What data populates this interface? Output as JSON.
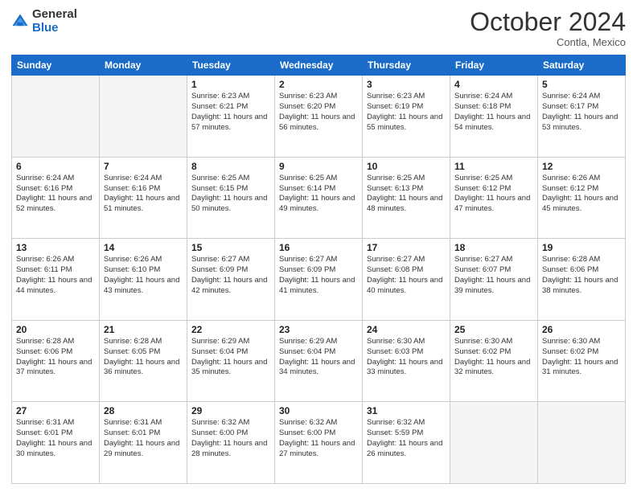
{
  "header": {
    "logo_general": "General",
    "logo_blue": "Blue",
    "month": "October 2024",
    "location": "Contla, Mexico"
  },
  "weekdays": [
    "Sunday",
    "Monday",
    "Tuesday",
    "Wednesday",
    "Thursday",
    "Friday",
    "Saturday"
  ],
  "weeks": [
    [
      {
        "day": "",
        "empty": true
      },
      {
        "day": "",
        "empty": true
      },
      {
        "day": "1",
        "sunrise": "Sunrise: 6:23 AM",
        "sunset": "Sunset: 6:21 PM",
        "daylight": "Daylight: 11 hours and 57 minutes."
      },
      {
        "day": "2",
        "sunrise": "Sunrise: 6:23 AM",
        "sunset": "Sunset: 6:20 PM",
        "daylight": "Daylight: 11 hours and 56 minutes."
      },
      {
        "day": "3",
        "sunrise": "Sunrise: 6:23 AM",
        "sunset": "Sunset: 6:19 PM",
        "daylight": "Daylight: 11 hours and 55 minutes."
      },
      {
        "day": "4",
        "sunrise": "Sunrise: 6:24 AM",
        "sunset": "Sunset: 6:18 PM",
        "daylight": "Daylight: 11 hours and 54 minutes."
      },
      {
        "day": "5",
        "sunrise": "Sunrise: 6:24 AM",
        "sunset": "Sunset: 6:17 PM",
        "daylight": "Daylight: 11 hours and 53 minutes."
      }
    ],
    [
      {
        "day": "6",
        "sunrise": "Sunrise: 6:24 AM",
        "sunset": "Sunset: 6:16 PM",
        "daylight": "Daylight: 11 hours and 52 minutes."
      },
      {
        "day": "7",
        "sunrise": "Sunrise: 6:24 AM",
        "sunset": "Sunset: 6:16 PM",
        "daylight": "Daylight: 11 hours and 51 minutes."
      },
      {
        "day": "8",
        "sunrise": "Sunrise: 6:25 AM",
        "sunset": "Sunset: 6:15 PM",
        "daylight": "Daylight: 11 hours and 50 minutes."
      },
      {
        "day": "9",
        "sunrise": "Sunrise: 6:25 AM",
        "sunset": "Sunset: 6:14 PM",
        "daylight": "Daylight: 11 hours and 49 minutes."
      },
      {
        "day": "10",
        "sunrise": "Sunrise: 6:25 AM",
        "sunset": "Sunset: 6:13 PM",
        "daylight": "Daylight: 11 hours and 48 minutes."
      },
      {
        "day": "11",
        "sunrise": "Sunrise: 6:25 AM",
        "sunset": "Sunset: 6:12 PM",
        "daylight": "Daylight: 11 hours and 47 minutes."
      },
      {
        "day": "12",
        "sunrise": "Sunrise: 6:26 AM",
        "sunset": "Sunset: 6:12 PM",
        "daylight": "Daylight: 11 hours and 45 minutes."
      }
    ],
    [
      {
        "day": "13",
        "sunrise": "Sunrise: 6:26 AM",
        "sunset": "Sunset: 6:11 PM",
        "daylight": "Daylight: 11 hours and 44 minutes."
      },
      {
        "day": "14",
        "sunrise": "Sunrise: 6:26 AM",
        "sunset": "Sunset: 6:10 PM",
        "daylight": "Daylight: 11 hours and 43 minutes."
      },
      {
        "day": "15",
        "sunrise": "Sunrise: 6:27 AM",
        "sunset": "Sunset: 6:09 PM",
        "daylight": "Daylight: 11 hours and 42 minutes."
      },
      {
        "day": "16",
        "sunrise": "Sunrise: 6:27 AM",
        "sunset": "Sunset: 6:09 PM",
        "daylight": "Daylight: 11 hours and 41 minutes."
      },
      {
        "day": "17",
        "sunrise": "Sunrise: 6:27 AM",
        "sunset": "Sunset: 6:08 PM",
        "daylight": "Daylight: 11 hours and 40 minutes."
      },
      {
        "day": "18",
        "sunrise": "Sunrise: 6:27 AM",
        "sunset": "Sunset: 6:07 PM",
        "daylight": "Daylight: 11 hours and 39 minutes."
      },
      {
        "day": "19",
        "sunrise": "Sunrise: 6:28 AM",
        "sunset": "Sunset: 6:06 PM",
        "daylight": "Daylight: 11 hours and 38 minutes."
      }
    ],
    [
      {
        "day": "20",
        "sunrise": "Sunrise: 6:28 AM",
        "sunset": "Sunset: 6:06 PM",
        "daylight": "Daylight: 11 hours and 37 minutes."
      },
      {
        "day": "21",
        "sunrise": "Sunrise: 6:28 AM",
        "sunset": "Sunset: 6:05 PM",
        "daylight": "Daylight: 11 hours and 36 minutes."
      },
      {
        "day": "22",
        "sunrise": "Sunrise: 6:29 AM",
        "sunset": "Sunset: 6:04 PM",
        "daylight": "Daylight: 11 hours and 35 minutes."
      },
      {
        "day": "23",
        "sunrise": "Sunrise: 6:29 AM",
        "sunset": "Sunset: 6:04 PM",
        "daylight": "Daylight: 11 hours and 34 minutes."
      },
      {
        "day": "24",
        "sunrise": "Sunrise: 6:30 AM",
        "sunset": "Sunset: 6:03 PM",
        "daylight": "Daylight: 11 hours and 33 minutes."
      },
      {
        "day": "25",
        "sunrise": "Sunrise: 6:30 AM",
        "sunset": "Sunset: 6:02 PM",
        "daylight": "Daylight: 11 hours and 32 minutes."
      },
      {
        "day": "26",
        "sunrise": "Sunrise: 6:30 AM",
        "sunset": "Sunset: 6:02 PM",
        "daylight": "Daylight: 11 hours and 31 minutes."
      }
    ],
    [
      {
        "day": "27",
        "sunrise": "Sunrise: 6:31 AM",
        "sunset": "Sunset: 6:01 PM",
        "daylight": "Daylight: 11 hours and 30 minutes."
      },
      {
        "day": "28",
        "sunrise": "Sunrise: 6:31 AM",
        "sunset": "Sunset: 6:01 PM",
        "daylight": "Daylight: 11 hours and 29 minutes."
      },
      {
        "day": "29",
        "sunrise": "Sunrise: 6:32 AM",
        "sunset": "Sunset: 6:00 PM",
        "daylight": "Daylight: 11 hours and 28 minutes."
      },
      {
        "day": "30",
        "sunrise": "Sunrise: 6:32 AM",
        "sunset": "Sunset: 6:00 PM",
        "daylight": "Daylight: 11 hours and 27 minutes."
      },
      {
        "day": "31",
        "sunrise": "Sunrise: 6:32 AM",
        "sunset": "Sunset: 5:59 PM",
        "daylight": "Daylight: 11 hours and 26 minutes."
      },
      {
        "day": "",
        "empty": true
      },
      {
        "day": "",
        "empty": true
      }
    ]
  ]
}
